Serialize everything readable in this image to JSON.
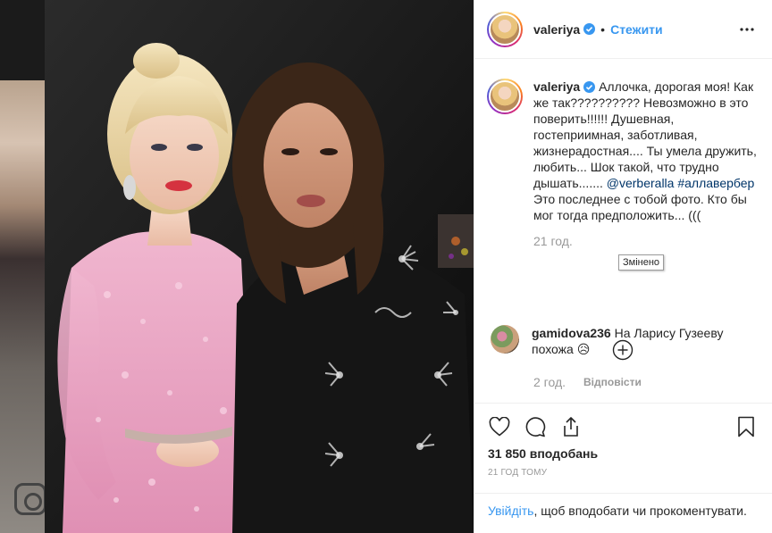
{
  "post": {
    "author": "valeriya",
    "follow_label": "Стежити",
    "dot": "•",
    "caption_user": "valeriya",
    "caption_body": "Аллочка, дорогая моя! Как же так?????????? Невозможно в это поверить!!!!!! Душевная, гостеприимная, заботливая, жизнерадостная.... Ты умела дружить, любить... Шок такой, что трудно дышать....... ",
    "caption_mention1": "@verberalla",
    "caption_hashtag": "#аллавербер",
    "caption_tail": " Это последнее с тобой фото. Кто бы мог тогда предположить... (((",
    "caption_time": "21 год.",
    "tooltip": "Змінено"
  },
  "comment": {
    "user": "gamidova236",
    "text": "На Ларису Гузееву похожа 😥",
    "time": "2 год.",
    "reply_label": "Відповісти"
  },
  "stats": {
    "likes": "31 850 вподобань",
    "posted_ago": "21 ГОД ТОМУ"
  },
  "login_prompt": {
    "link": "Увійдіть",
    "text": ", щоб вподобати чи прокоментувати."
  },
  "colors": {
    "accent": "#3897f0",
    "dress_pink": "#e9a7c4",
    "jacket_black": "#151515"
  }
}
